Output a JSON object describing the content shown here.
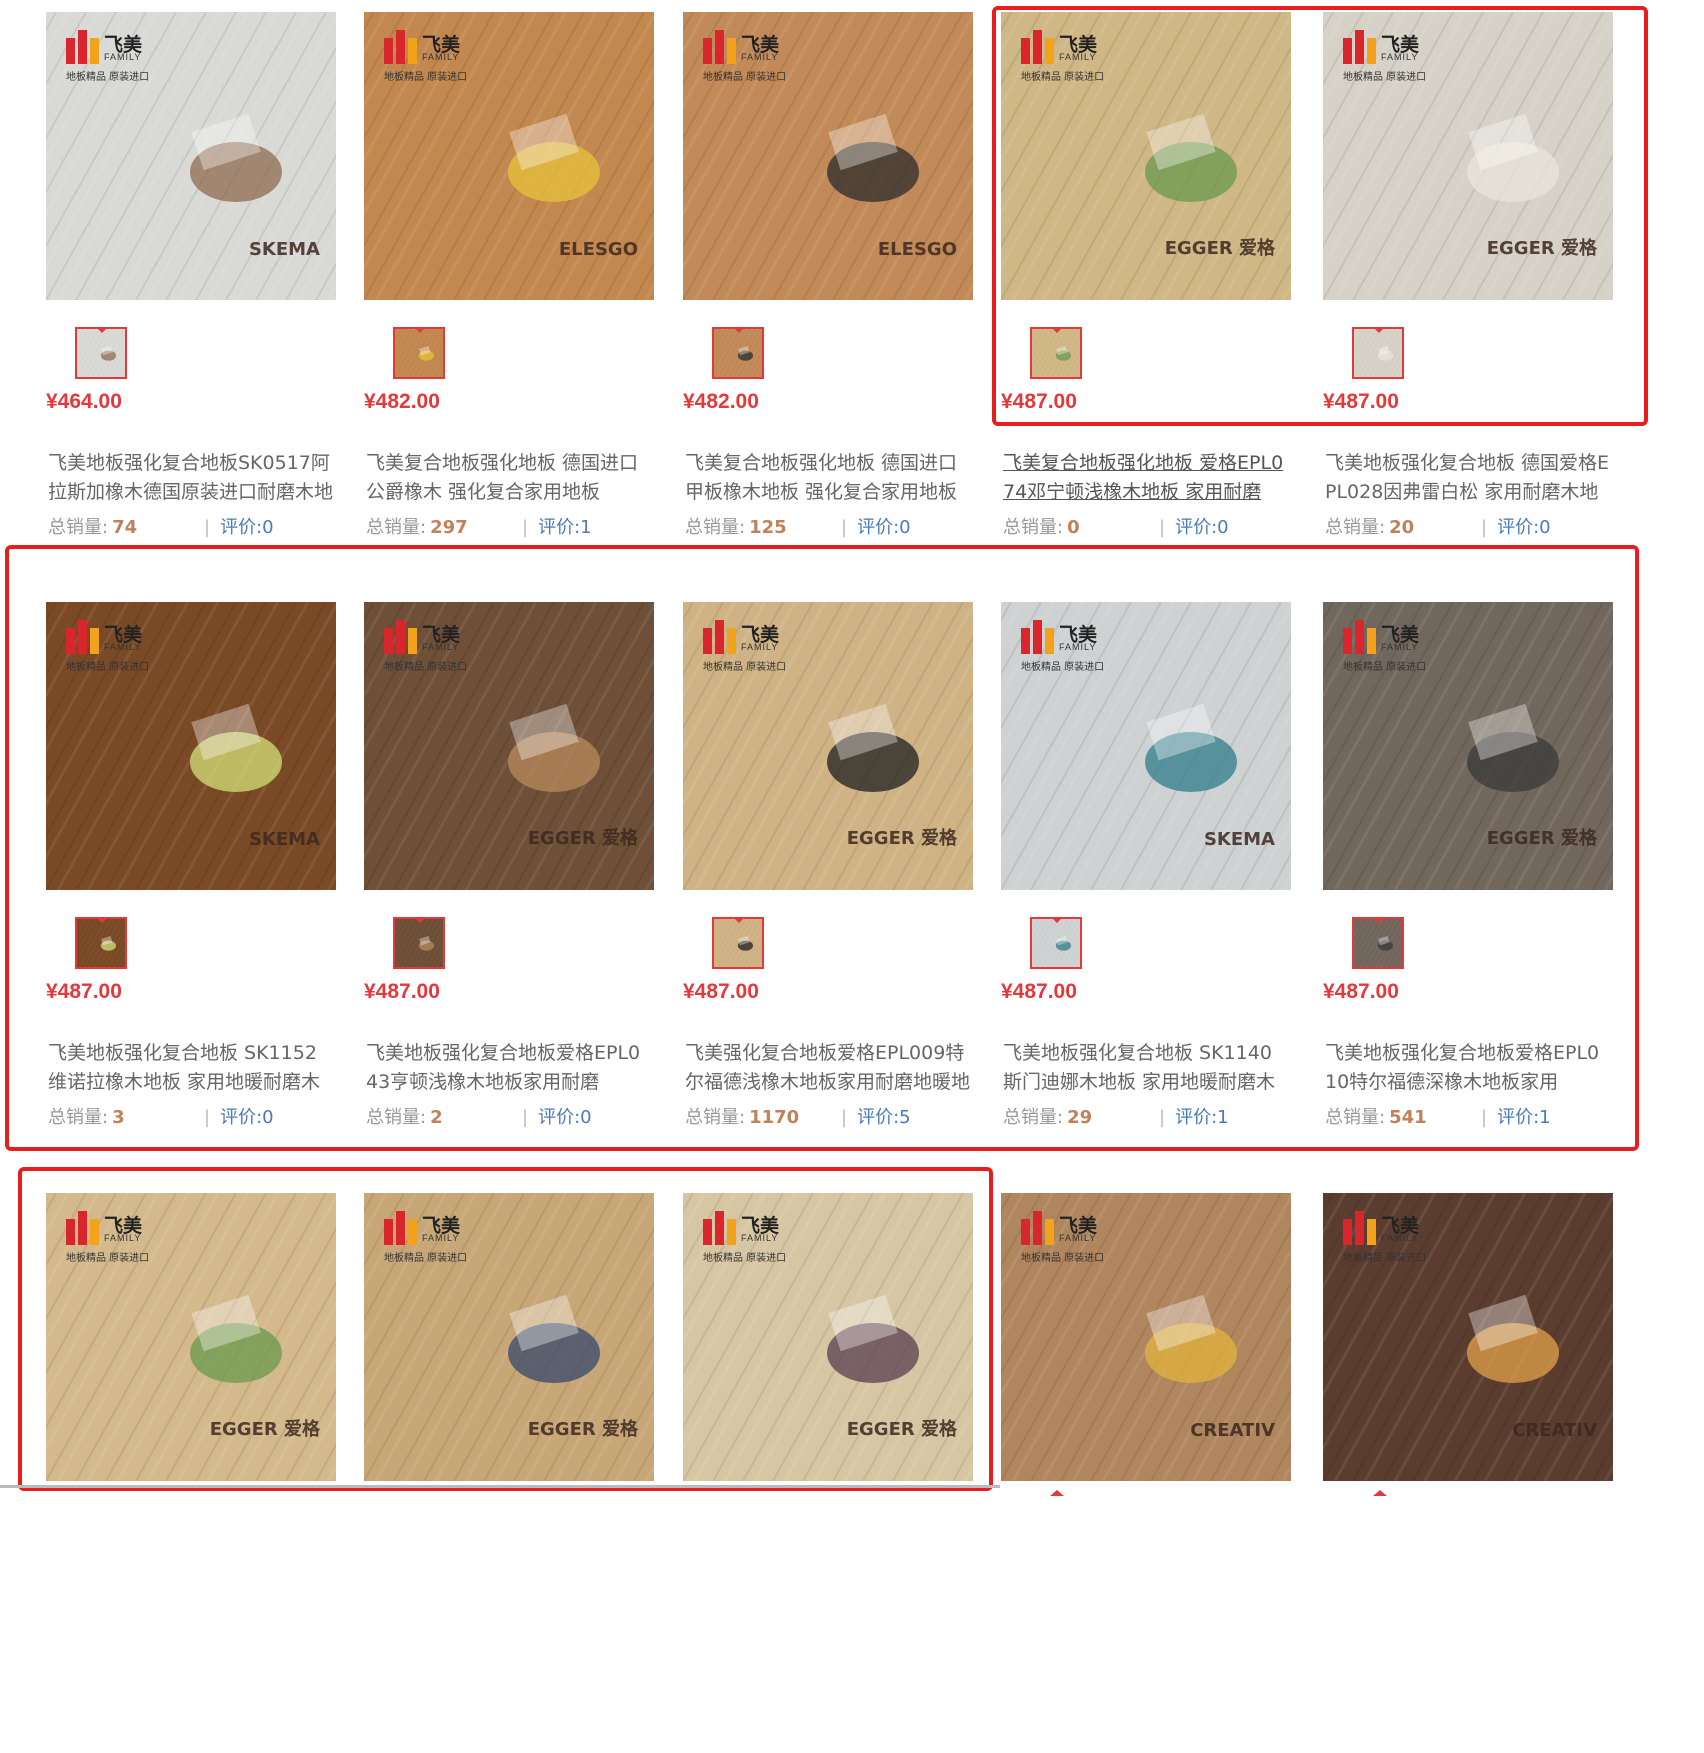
{
  "labels": {
    "sold": "总销量:",
    "reviews": "评价:"
  },
  "products": [
    {
      "title": "飞美地板强化复合地板SK0517阿拉斯加橡木德国原装进口耐磨木地板",
      "price": "¥464.00",
      "sold": "74",
      "reviews": "0",
      "brand": "SKEMA",
      "floor": "#d9d9d6",
      "accent": "#8d6a4f"
    },
    {
      "title": "飞美复合地板强化地板 德国进口公爵橡木 强化复合家用地板",
      "price": "¥482.00",
      "sold": "297",
      "reviews": "1",
      "brand": "ELESGO",
      "floor": "#c3884f",
      "accent": "#e7c23a"
    },
    {
      "title": "飞美复合地板强化地板 德国进口甲板橡木地板 强化复合家用地板",
      "price": "¥482.00",
      "sold": "125",
      "reviews": "0",
      "brand": "ELESGO",
      "floor": "#c28a58",
      "accent": "#2b2b2b"
    },
    {
      "title": "飞美复合地板强化地板 爱格EPL074邓宁顿浅橡木地板 家用耐磨",
      "price": "¥487.00",
      "sold": "0",
      "reviews": "0",
      "brand": "EGGER 爱格",
      "floor": "#d0b786",
      "accent": "#6a9a4d"
    },
    {
      "title": "飞美地板强化复合地板 德国爱格EPL028因弗雷白松 家用耐磨木地板",
      "price": "¥487.00",
      "sold": "20",
      "reviews": "0",
      "brand": "EGGER 爱格",
      "floor": "#d7d2c8",
      "accent": "#e9e4da"
    },
    {
      "title": "飞美地板强化复合地板 SK1152维诺拉橡木地板 家用地暖耐磨木地板",
      "price": "¥487.00",
      "sold": "3",
      "reviews": "0",
      "brand": "SKEMA",
      "floor": "#7a4a26",
      "accent": "#d5e07a"
    },
    {
      "title": "飞美地板强化复合地板爱格EPL043亨顿浅橡木地板家用耐磨",
      "price": "¥487.00",
      "sold": "2",
      "reviews": "0",
      "brand": "EGGER 爱格",
      "floor": "#6e4f37",
      "accent": "#b88a5c"
    },
    {
      "title": "飞美强化复合地板爱格EPL009特尔福德浅橡木地板家用耐磨地暖地板",
      "price": "¥487.00",
      "sold": "1170",
      "reviews": "5",
      "brand": "EGGER 爱格",
      "floor": "#cfb385",
      "accent": "#1f1f1f"
    },
    {
      "title": "飞美地板强化复合地板 SK1140斯门迪娜木地板 家用地暖耐磨木地板",
      "price": "¥487.00",
      "sold": "29",
      "reviews": "1",
      "brand": "SKEMA",
      "floor": "#cfd2d3",
      "accent": "#2f7c8a"
    },
    {
      "title": "飞美地板强化复合地板爱格EPL010特尔福德深橡木地板家用",
      "price": "¥487.00",
      "sold": "541",
      "reviews": "1",
      "brand": "EGGER 爱格",
      "floor": "#72675c",
      "accent": "#3a3a3a"
    },
    {
      "brand": "EGGER 爱格",
      "floor": "#d3b98c",
      "accent": "#6a9a4d"
    },
    {
      "brand": "EGGER 爱格",
      "floor": "#c7a777",
      "accent": "#35486b"
    },
    {
      "brand": "EGGER 爱格",
      "floor": "#d7c6a3",
      "accent": "#5a3d4f"
    },
    {
      "brand": "CREATIV",
      "floor": "#b0865f",
      "accent": "#e2b13c"
    },
    {
      "brand": "CREATIV",
      "floor": "#5b3d2f",
      "accent": "#e0a04a"
    }
  ],
  "logo": {
    "cn": "飞美",
    "en": "FAMILY",
    "tagline": "地板精品 原装进口"
  }
}
